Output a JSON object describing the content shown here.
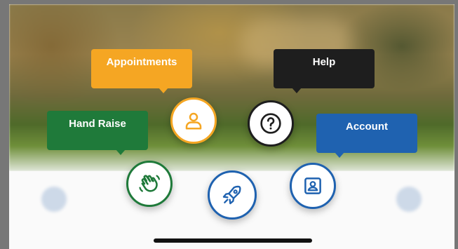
{
  "tooltips": {
    "appointments": "Appointments",
    "help": "Help",
    "hand_raise": "Hand Raise",
    "account": "Account"
  },
  "buttons": {
    "appointments": {
      "icon": "person-icon",
      "color": "#f5a623"
    },
    "help": {
      "icon": "question-icon",
      "color": "#1e1e1e"
    },
    "hand_raise": {
      "icon": "waving-hand-icon",
      "color": "#1f7a3a"
    },
    "main": {
      "icon": "rocket-icon",
      "color": "#1f62b0"
    },
    "account": {
      "icon": "contact-card-icon",
      "color": "#1f62b0"
    }
  },
  "colors": {
    "appointments": "#f5a623",
    "help": "#1e1e1e",
    "hand_raise": "#1f7a3a",
    "account": "#1f62b0"
  }
}
